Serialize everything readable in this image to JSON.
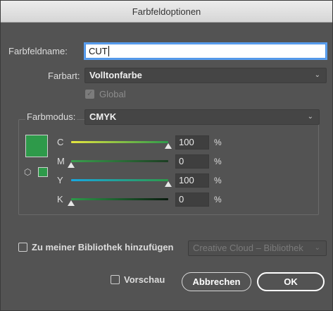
{
  "dialog": {
    "title": "Farbfeldoptionen",
    "name_label": "Farbfeldname:",
    "name_value": "CUT",
    "type_label": "Farbart:",
    "type_value": "Volltonfarbe",
    "global_label": "Global",
    "mode_label": "Farbmodus:",
    "mode_value": "CMYK",
    "swatch_color": "#2e9a4a",
    "channels": [
      {
        "label": "C",
        "value": "100",
        "pct": "%",
        "level": 1.0,
        "gradient": "linear-gradient(90deg,#e5e640,#2d9a4a)"
      },
      {
        "label": "M",
        "value": "0",
        "pct": "%",
        "level": 0.0,
        "gradient": "linear-gradient(90deg,#3aa04e,#1c3d22)"
      },
      {
        "label": "Y",
        "value": "100",
        "pct": "%",
        "level": 1.0,
        "gradient": "linear-gradient(90deg,#17a8e0,#2d9a4a)"
      },
      {
        "label": "K",
        "value": "0",
        "pct": "%",
        "level": 0.0,
        "gradient": "linear-gradient(90deg,#2e9a4a,#0a1a0e)"
      }
    ],
    "library_label": "Zu meiner Bibliothek hinzufügen",
    "library_select": "Creative Cloud – Bibliothek",
    "preview_label": "Vorschau",
    "cancel_label": "Abbrechen",
    "ok_label": "OK"
  }
}
